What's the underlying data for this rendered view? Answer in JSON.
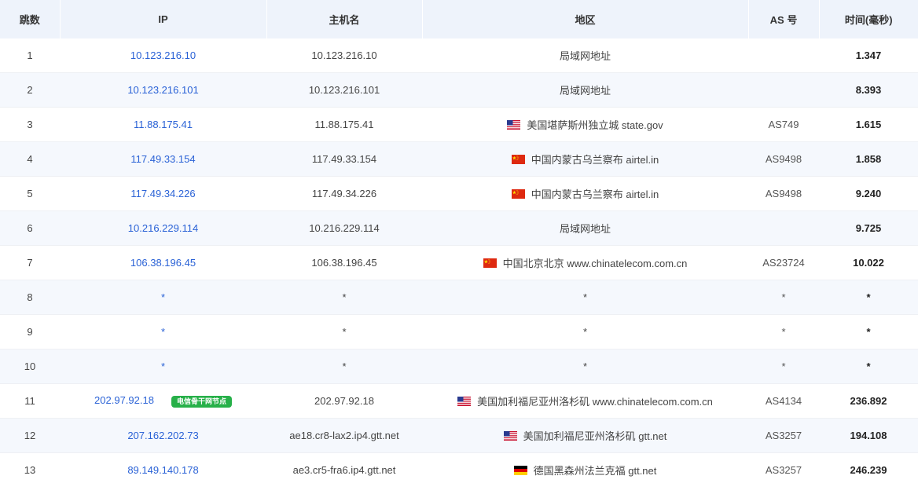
{
  "headers": {
    "hop": "跳数",
    "ip": "IP",
    "host": "主机名",
    "region": "地区",
    "as": "AS 号",
    "time": "时间(毫秒)"
  },
  "rows": [
    {
      "hop": "1",
      "ip": "10.123.216.10",
      "host": "10.123.216.10",
      "flag": "",
      "region": "局域网地址",
      "as": "",
      "time": "1.347"
    },
    {
      "hop": "2",
      "ip": "10.123.216.101",
      "host": "10.123.216.101",
      "flag": "",
      "region": "局域网地址",
      "as": "",
      "time": "8.393"
    },
    {
      "hop": "3",
      "ip": "11.88.175.41",
      "host": "11.88.175.41",
      "flag": "us-flag-icon",
      "region": "美国堪萨斯州独立城 state.gov",
      "as": "AS749",
      "time": "1.615"
    },
    {
      "hop": "4",
      "ip": "117.49.33.154",
      "host": "117.49.33.154",
      "flag": "cn-flag-icon",
      "region": "中国内蒙古乌兰察布 airtel.in",
      "as": "AS9498",
      "time": "1.858"
    },
    {
      "hop": "5",
      "ip": "117.49.34.226",
      "host": "117.49.34.226",
      "flag": "cn-flag-icon",
      "region": "中国内蒙古乌兰察布 airtel.in",
      "as": "AS9498",
      "time": "9.240"
    },
    {
      "hop": "6",
      "ip": "10.216.229.114",
      "host": "10.216.229.114",
      "flag": "",
      "region": "局域网地址",
      "as": "",
      "time": "9.725"
    },
    {
      "hop": "7",
      "ip": "106.38.196.45",
      "host": "106.38.196.45",
      "flag": "cn-flag-icon",
      "region": "中国北京北京 www.chinatelecom.com.cn",
      "as": "AS23724",
      "time": "10.022"
    },
    {
      "hop": "8",
      "ip": "*",
      "host": "*",
      "flag": "",
      "region": "*",
      "as": "*",
      "time": "*"
    },
    {
      "hop": "9",
      "ip": "*",
      "host": "*",
      "flag": "",
      "region": "*",
      "as": "*",
      "time": "*"
    },
    {
      "hop": "10",
      "ip": "*",
      "host": "*",
      "flag": "",
      "region": "*",
      "as": "*",
      "time": "*"
    },
    {
      "hop": "11",
      "ip": "202.97.92.18",
      "badge": "电信骨干网节点",
      "host": "202.97.92.18",
      "flag": "us-flag-icon",
      "region": "美国加利福尼亚州洛杉矶 www.chinatelecom.com.cn",
      "as": "AS4134",
      "time": "236.892"
    },
    {
      "hop": "12",
      "ip": "207.162.202.73",
      "host": "ae18.cr8-lax2.ip4.gtt.net",
      "flag": "us-flag-icon",
      "region": "美国加利福尼亚州洛杉矶 gtt.net",
      "as": "AS3257",
      "time": "194.108"
    },
    {
      "hop": "13",
      "ip": "89.149.140.178",
      "host": "ae3.cr5-fra6.ip4.gtt.net",
      "flag": "de-flag-icon",
      "region": "德国黑森州法兰克福 gtt.net",
      "as": "AS3257",
      "time": "246.239"
    }
  ],
  "colors": {
    "link": "#2a62d6",
    "badge": "#27b049",
    "header_bg": "#eef3fb",
    "stripe_bg": "#f5f8fd"
  }
}
